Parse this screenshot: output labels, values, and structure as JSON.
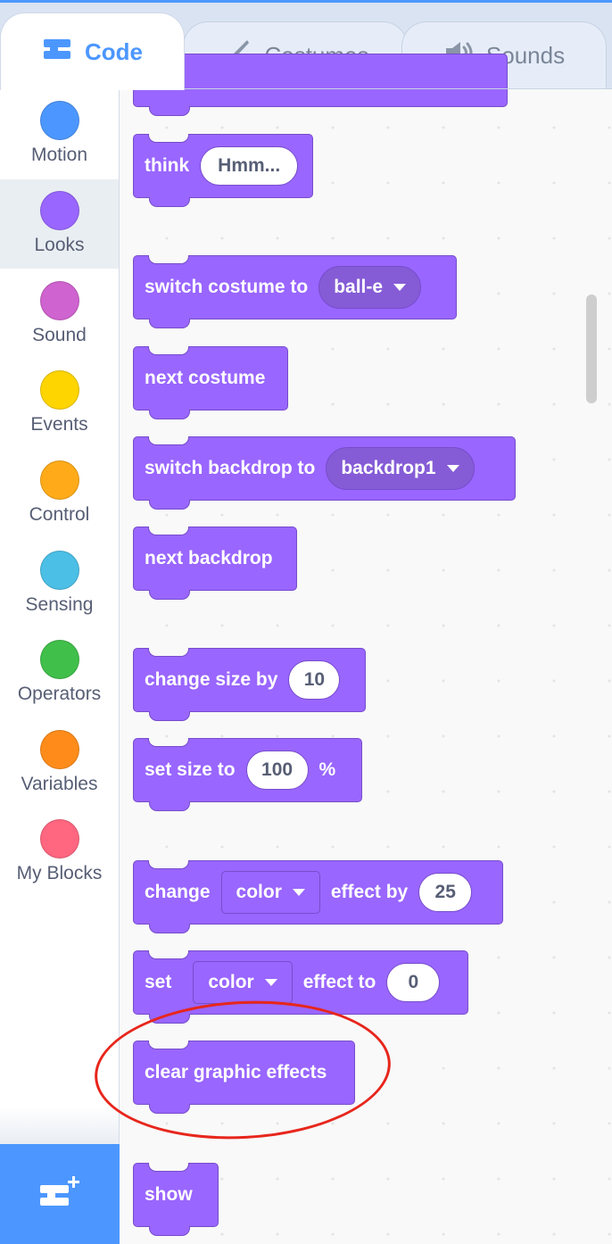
{
  "tabs": {
    "code": {
      "label": "Code",
      "icon": "code-blocks-icon"
    },
    "costumes": {
      "label": "Costumes",
      "icon": "paintbrush-icon"
    },
    "sounds": {
      "label": "Sounds",
      "icon": "speaker-icon"
    }
  },
  "categories": [
    {
      "label": "Motion",
      "color": "#4c97ff"
    },
    {
      "label": "Looks",
      "color": "#9966ff",
      "selected": true
    },
    {
      "label": "Sound",
      "color": "#cf63cf"
    },
    {
      "label": "Events",
      "color": "#ffd500"
    },
    {
      "label": "Control",
      "color": "#ffab19"
    },
    {
      "label": "Sensing",
      "color": "#4cbfe6"
    },
    {
      "label": "Operators",
      "color": "#40bf4a"
    },
    {
      "label": "Variables",
      "color": "#ff8c1a"
    },
    {
      "label": "My Blocks",
      "color": "#ff6680"
    }
  ],
  "extension_button": {
    "icon": "add-extension-icon"
  },
  "blocks": {
    "think": {
      "label": "think",
      "input": "Hmm..."
    },
    "switch_costume": {
      "label": "switch costume to",
      "value": "ball-e"
    },
    "next_costume": {
      "label": "next costume"
    },
    "switch_backdrop": {
      "label": "switch backdrop to",
      "value": "backdrop1"
    },
    "next_backdrop": {
      "label": "next backdrop"
    },
    "change_size": {
      "label": "change size by",
      "input": "10"
    },
    "set_size": {
      "label": "set size to",
      "input": "100",
      "suffix": "%"
    },
    "change_effect": {
      "label": "change",
      "effect": "color",
      "label2": "effect by",
      "input": "25"
    },
    "set_effect": {
      "label": "set",
      "effect": "color",
      "label2": "effect to",
      "input": "0"
    },
    "clear_effects": {
      "label": "clear graphic effects"
    },
    "show": {
      "label": "show"
    }
  },
  "colors": {
    "looks_block": "#9966ff",
    "looks_block_border": "#774dcb",
    "accent": "#4c97ff",
    "highlight_ring": "#e7261c"
  }
}
